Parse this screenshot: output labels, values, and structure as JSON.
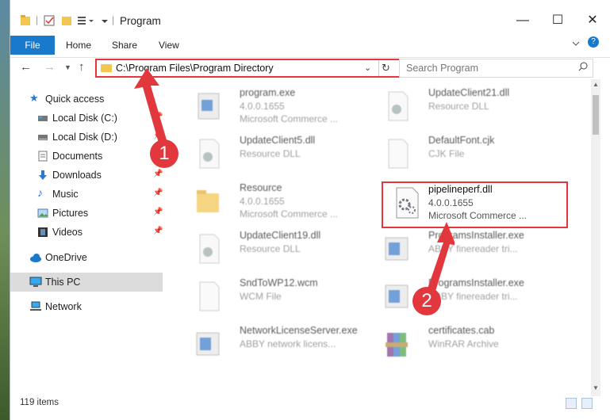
{
  "window": {
    "title": "Program",
    "controls": {
      "minimize": "—",
      "maximize": "☐",
      "close": "✕"
    }
  },
  "ribbon": {
    "tabs": [
      "File",
      "Home",
      "Share",
      "View"
    ]
  },
  "address_bar": {
    "path": "C:\\Program Files\\Program Directory",
    "search_placeholder": "Search Program"
  },
  "sidebar": {
    "items": [
      {
        "label": "Quick access",
        "icon": "star-icon"
      },
      {
        "label": "Local Disk (C:)",
        "icon": "drive-icon"
      },
      {
        "label": "Local Disk (D:)",
        "icon": "drive-icon"
      },
      {
        "label": "Documents",
        "icon": "documents-icon"
      },
      {
        "label": "Downloads",
        "icon": "download-icon"
      },
      {
        "label": "Music",
        "icon": "music-icon"
      },
      {
        "label": "Pictures",
        "icon": "pictures-icon"
      },
      {
        "label": "Videos",
        "icon": "videos-icon"
      },
      {
        "label": "OneDrive",
        "icon": "cloud-icon"
      },
      {
        "label": "This PC",
        "icon": "computer-icon"
      },
      {
        "label": "Network",
        "icon": "network-icon"
      }
    ]
  },
  "files": [
    {
      "name": "program.exe",
      "line2": "4.0.0.1655",
      "line3": "Microsoft Commerce ..."
    },
    {
      "name": "UpdateClient21.dll",
      "line2": "Resource DLL",
      "line3": ""
    },
    {
      "name": "UpdateClient5.dll",
      "line2": "Resource DLL",
      "line3": ""
    },
    {
      "name": "DefaultFont.cjk",
      "line2": "CJK File",
      "line3": ""
    },
    {
      "name": "Resource",
      "line2": "4.0.0.1655",
      "line3": "Microsoft Commerce ..."
    },
    {
      "name": "pipelineperf.dll",
      "line2": "4.0.0.1655",
      "line3": "Microsoft Commerce ..."
    },
    {
      "name": "UpdateClient19.dll",
      "line2": "Resource DLL",
      "line3": ""
    },
    {
      "name": "ProgramsInstaller.exe",
      "line2": "ABBY finereader tri...",
      "line3": ""
    },
    {
      "name": "SndToWP12.wcm",
      "line2": "WCM File",
      "line3": ""
    },
    {
      "name": "ProgramsInstaller.exe",
      "line2": "ABBY finereader tri...",
      "line3": ""
    },
    {
      "name": "NetworkLicenseServer.exe",
      "line2": "ABBY network licens...",
      "line3": ""
    },
    {
      "name": "certificates.cab",
      "line2": "WinRAR Archive",
      "line3": ""
    }
  ],
  "status": {
    "item_count": "119 items"
  },
  "callouts": [
    "1",
    "2"
  ],
  "colors": {
    "accent": "#1979ca",
    "highlight": "#e2373c"
  }
}
